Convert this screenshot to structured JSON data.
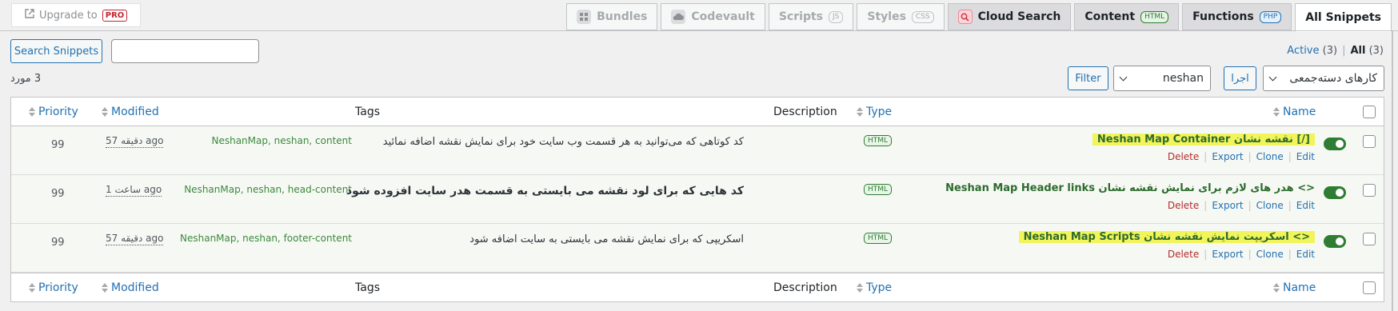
{
  "upgrade": {
    "label": "Upgrade to",
    "pro": "PRO"
  },
  "tabs": [
    {
      "label": "Bundles",
      "badge": ""
    },
    {
      "label": "Codevault",
      "badge": ""
    },
    {
      "label": "Scripts",
      "badge": "JS"
    },
    {
      "label": "Styles",
      "badge": "CSS"
    },
    {
      "label": "Cloud Search",
      "badge": ""
    },
    {
      "label": "Content",
      "badge": "HTML"
    },
    {
      "label": "Functions",
      "badge": "PHP"
    },
    {
      "label": "All Snippets",
      "badge": ""
    }
  ],
  "toolbar": {
    "search_button": "Search Snippets",
    "search_value": "",
    "views": {
      "active_label": "Active",
      "active_count": "(3)",
      "separator": "|",
      "all_label": "All",
      "all_count": "(3)"
    },
    "items_count": "3 مورد",
    "filter_button": "Filter",
    "tag_filter": "neshan",
    "apply_button": "اجرا",
    "bulk_actions": "کارهای دسته‌جمعی"
  },
  "columns": {
    "priority": "Priority",
    "modified": "Modified",
    "tags": "Tags",
    "description": "Description",
    "type": "Type",
    "name": "Name"
  },
  "rows": [
    {
      "priority": "99",
      "modified": "57 دقیقه ago",
      "tags": "NeshanMap, neshan, content",
      "description": "کد کوتاهی که می‌توانید به هر قسمت وب سایت خود برای نمایش نقشه اضافه نمائید",
      "type": "HTML",
      "name": "Neshan Map Container نقشه نشان [/]",
      "actions": {
        "delete": "Delete",
        "export": "Export",
        "clone": "Clone",
        "edit": "Edit"
      },
      "active": true
    },
    {
      "priority": "99",
      "modified": "1 ساعت ago",
      "tags": "NeshanMap, neshan, head-content",
      "description": "کد هایی که برای لود نقشه می بایستی به قسمت هدر سایت افزوده شود",
      "type": "HTML",
      "name": "Neshan Map Header links هدر های لازم برای نمایش نقشه نشان <>",
      "actions": {
        "delete": "Delete",
        "export": "Export",
        "clone": "Clone",
        "edit": "Edit"
      },
      "active": true
    },
    {
      "priority": "99",
      "modified": "57 دقیقه ago",
      "tags": "NeshanMap, neshan, footer-content",
      "description": "اسکریپی که برای نمایش نقشه می بایستی به سایت اضافه شود",
      "type": "HTML",
      "name": "Neshan Map Scripts اسکریپت نمایش نقشه نشان <>",
      "actions": {
        "delete": "Delete",
        "export": "Export",
        "clone": "Clone",
        "edit": "Edit"
      },
      "active": true
    }
  ],
  "colors": {
    "accent": "#2271b1",
    "toggle_on": "#2e7d32",
    "highlight": "#f2f55a",
    "delete": "#b32d2e"
  }
}
